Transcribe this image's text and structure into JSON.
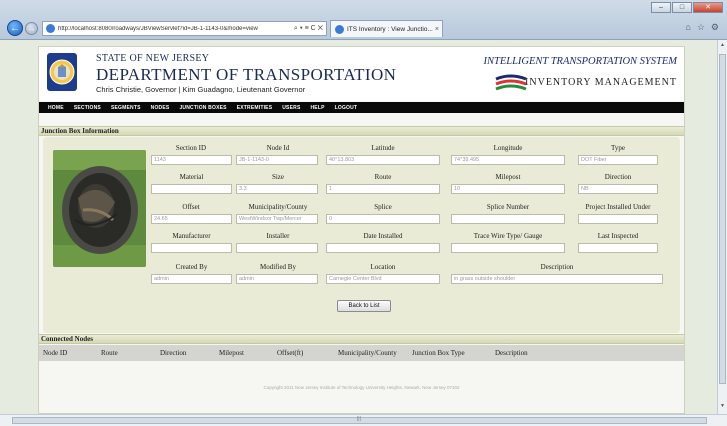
{
  "browser": {
    "url": "http://localhost:8080/roadways/JBViewServlet?id=JB-1-1143-0&mode=view",
    "address_icons": "⌕ ▾ ≡ C ✕",
    "tab_title": "ITS Inventory : View Junctio...",
    "tab_close": "×",
    "win_min": "–",
    "win_max": "□",
    "win_close": "✕",
    "back_glyph": "←",
    "forward_glyph": "→",
    "icons": [
      "home-icon",
      "star-icon",
      "gear-icon"
    ],
    "tool_glyphs": [
      "⌂",
      "☆",
      "⚙"
    ]
  },
  "header": {
    "state": "STATE OF NEW JERSEY",
    "department": "DEPARTMENT OF TRANSPORTATION",
    "governor": "Chris Christie, Governor | Kim Guadagno, Lieutenant Governor",
    "system_title": "INTELLIGENT TRANSPORTATION SYSTEM",
    "system_subtitle": "INVENTORY MANAGEMENT",
    "seal_text": "STATE OF NEW JERSEY"
  },
  "nav": [
    "HOME",
    "SECTIONS",
    "SEGMENTS",
    "NODES",
    "JUNCTION BOXES",
    "EXTREMITIES",
    "USERS",
    "HELP",
    "LOGOUT"
  ],
  "junction_box": {
    "title": "Junction Box Information",
    "fields": {
      "section_id": {
        "label": "Section ID",
        "value": "1143"
      },
      "node_id": {
        "label": "Node Id",
        "value": "JB-1-1143-0"
      },
      "latitude": {
        "label": "Latitude",
        "value": "40°13.803"
      },
      "longitude": {
        "label": "Longitude",
        "value": "74°39.495"
      },
      "type": {
        "label": "Type",
        "value": "DOT Fiber"
      },
      "material": {
        "label": "Material",
        "value": ""
      },
      "size": {
        "label": "Size",
        "value": "3.3"
      },
      "route": {
        "label": "Route",
        "value": "1"
      },
      "milepost": {
        "label": "Milepost",
        "value": "10"
      },
      "direction": {
        "label": "Direction",
        "value": "NB"
      },
      "offset": {
        "label": "Offset",
        "value": "24.65"
      },
      "municipality": {
        "label": "Municipality/County",
        "value": "WestWindsor Twp/Mercer"
      },
      "splice": {
        "label": "Splice",
        "value": "0"
      },
      "splice_number": {
        "label": "Splice Number",
        "value": ""
      },
      "project_installed": {
        "label": "Project Installed Under",
        "value": ""
      },
      "manufacturer": {
        "label": "Manufacturer",
        "value": ""
      },
      "installer": {
        "label": "Installer",
        "value": ""
      },
      "date_installed": {
        "label": "Date Installed",
        "value": ""
      },
      "trace_wire": {
        "label": "Trace Wire Type/ Gauge",
        "value": ""
      },
      "last_inspected": {
        "label": "Last Inspected",
        "value": ""
      },
      "created_by": {
        "label": "Created By",
        "value": "admin"
      },
      "modified_by": {
        "label": "Modified By",
        "value": "admin"
      },
      "location": {
        "label": "Location",
        "value": "Carnegie Center Blvd"
      },
      "description": {
        "label": "Description",
        "value": "in grass outside shoulder"
      }
    },
    "back_button": "Back to List"
  },
  "connected_nodes": {
    "title": "Connected Nodes",
    "columns": [
      "Node ID",
      "Route",
      "Direction",
      "Milepost",
      "Offset(ft)",
      "Municipality/County",
      "Junction Box Type",
      "Description"
    ]
  },
  "footer": "Copyright 2011 New Jersey Institute of Technology   University Heights, Newark, New Jersey 07102"
}
